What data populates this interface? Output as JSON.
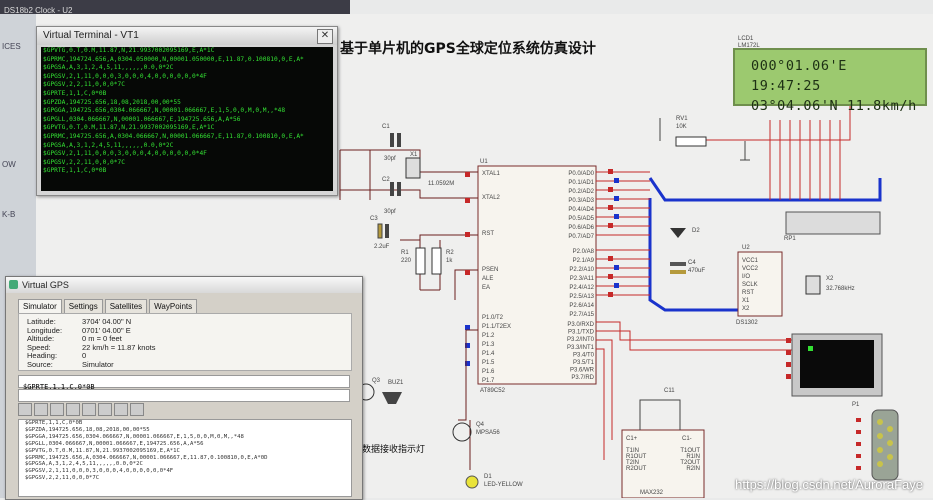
{
  "window": {
    "app_title": "DS18b2 Clock - U2",
    "side_labels": [
      "ICES",
      "OW",
      "K-B"
    ]
  },
  "schematic_title": "基于单片机的GPS全球定位系统仿真设计",
  "led_label": "数据接收指示灯",
  "lcd": {
    "ref": "LCD1",
    "model": "LM172L",
    "line1": "000°01.06'E 19:47:25",
    "line2": "03°04.06'N 11.8km/h"
  },
  "components": {
    "mcu_ref": "U1",
    "mcu_model": "AT89C52",
    "crystal": "X1",
    "crystal_value": "11.0592M",
    "c1": "C1",
    "c1_value": "30pf",
    "c2": "C2",
    "c2_value": "30pf",
    "c3": "C3",
    "c3_value": "2.2uF",
    "r1": "R1",
    "r1_value": "220",
    "r2": "R2",
    "r2_value": "1k",
    "rv1": "RV1",
    "rv1_value": "10K",
    "rp1": "RP1",
    "d2": "D2",
    "c4": "C4",
    "c4_value": "470uF",
    "u2": "U2",
    "u2_model": "DS1302",
    "x2": "X2",
    "x2_value": "32.768kHz",
    "q3": "Q3",
    "q4": "Q4",
    "q4_model": "MPSA56",
    "d1": "D1",
    "d1_model": "LED-YELLOW",
    "bz1": "BUZ1",
    "c11": "C11",
    "u3_model": "MAX232",
    "p1": "P1",
    "mcu_left_pins": [
      "XTAL1",
      "XTAL2",
      "RST",
      "PSEN",
      "ALE",
      "EA",
      "P1.0/T2",
      "P1.1/T2EX",
      "P1.2",
      "P1.3",
      "P1.4",
      "P1.5",
      "P1.6",
      "P1.7"
    ],
    "mcu_right_pins": [
      "P0.0/AD0",
      "P0.1/AD1",
      "P0.2/AD2",
      "P0.3/AD3",
      "P0.4/AD4",
      "P0.5/AD5",
      "P0.6/AD6",
      "P0.7/AD7",
      "P2.0/A8",
      "P2.1/A9",
      "P2.2/A10",
      "P2.3/A11",
      "P2.4/A12",
      "P2.5/A13",
      "P2.6/A14",
      "P2.7/A15",
      "P3.0/RXD",
      "P3.1/TXD",
      "P3.2/INT0",
      "P3.3/INT1",
      "P3.4/T0",
      "P3.5/T1",
      "P3.6/WR",
      "P3.7/RD"
    ],
    "ds1302_pins": [
      "VCC1",
      "VCC2",
      "I/O",
      "SCLK",
      "RST",
      "X1",
      "X2"
    ],
    "max232_pins": [
      "C1+",
      "C1-",
      "T1IN",
      "R1OUT",
      "T2IN",
      "R2OUT",
      "T1OUT",
      "R1IN",
      "T2OUT",
      "R2IN"
    ]
  },
  "virtual_terminal": {
    "title": "Virtual Terminal - VT1",
    "lines": [
      "$GPVTG,0.T,0.M,11.87,N,21.9937002095169,E,A*1C",
      "$GPRMC,194724.656,A,0304.050000,N,00001.050000,E,11.87,0.100810,0,E,A*",
      "$GPGSA,A,3,1,2,4,5,11,,,,,,0.0,0*2C",
      "$GPGSV,2,1,11,0,0,0,3,0,0,0,4,0,0,0,0,0,0*4F",
      "$GPGSV,2,2,11,0,0,0*7C",
      "$GPRTE,1,1,C,0*0B",
      "$GPZDA,194725.656,18,08,2018,00,00*55",
      "$GPGGA,194725.656,0304.066667,N,00001.066667,E,1,5,0,0,M,0,M,,*48",
      "$GPGLL,0304.066667,N,00001.066667,E,194725.656,A,A*56",
      "$GPVTG,0.T,0.M,11.87,N,21.9937002095169,E,A*1C",
      "$GPRMC,194725.656,A,0304.066667,N,00001.066667,E,11.87,0.100810,0,E,A*",
      "$GPGSA,A,3,1,2,4,5,11,,,,,,0.0,0*2C",
      "$GPGSV,2,1,11,0,0,0,3,0,0,0,4,0,0,0,0,0,0*4F",
      "$GPGSV,2,2,11,0,0,0*7C",
      "$GPRTE,1,1,C,0*0B"
    ]
  },
  "virtual_gps": {
    "title": "Virtual GPS",
    "tabs": [
      "Simulator",
      "Settings",
      "Satellites",
      "WayPoints"
    ],
    "active_tab": "Simulator",
    "fields": [
      {
        "label": "Latitude:",
        "value": "3704' 04.00\" N"
      },
      {
        "label": "Longitude:",
        "value": "0701' 04.00\" E"
      },
      {
        "label": "Altitude:",
        "value": "0 m = 0 feet"
      },
      {
        "label": "Speed:",
        "value": "22 km/h = 11.87 knots"
      },
      {
        "label": "Heading:",
        "value": "0"
      },
      {
        "label": "Source:",
        "value": "Simulator"
      }
    ],
    "current_sentence": "$GPRTE,1,1,C,0*0B",
    "log_lines": [
      "$GPRTE,1,1,C,0*0B",
      "",
      "$GPZDA,194725.656,18,08,2018,00,00*55",
      "$GPGGA,194725.656,0304.066667,N,00001.066667,E,1,5,0,0,M,0,M,,*48",
      "$GPGLL,0304.066667,N,00001.066667,E,194725.656,A,A*56",
      "$GPVTG,0.T,0.M,11.87,N,21.9937002095169,E,A*1C",
      "$GPRMC,194725.656,A,0304.066667,N,00001.066667,E,11.87,0.100810,0,E,A*0D",
      "$GPGSA,A,3,1,2,4,5,11,,,,,,0.0,0*2C",
      "$GPGSV,2,1,11,0,0,0,3,0,0,0,4,0,0,0,0,0,0*4F",
      "$GPGSV,2,2,11,0,0,0*7C"
    ]
  },
  "watermark": "https://blog.csdn.net/AuroraFaye",
  "icons": [
    "close-icon",
    "gps-icon",
    "resize-icon"
  ],
  "colors": {
    "terminal_bg": "#060806",
    "terminal_text": "#33e033",
    "lcd_bg": "#9cc96f",
    "wire_red": "#c62828",
    "bus_blue": "#1a33cc"
  }
}
